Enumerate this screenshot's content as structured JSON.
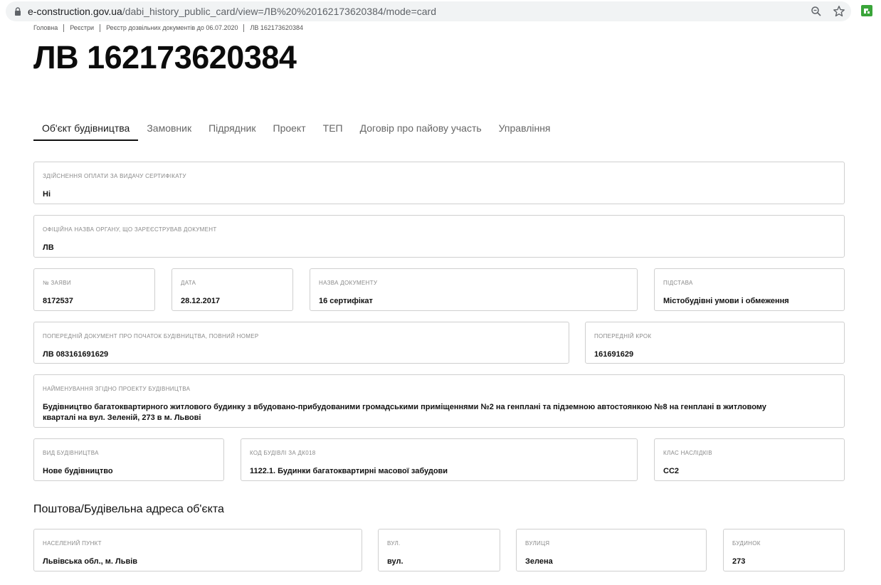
{
  "browser": {
    "url_host": "e-construction.gov.ua",
    "url_path": "/dabi_history_public_card/view=ЛВ%20%20162173620384/mode=card"
  },
  "breadcrumb": [
    "Головна",
    "Реєстри",
    "Реєстр дозвільних документів до 06.07.2020",
    "ЛВ 162173620384"
  ],
  "page_title": "ЛВ 162173620384",
  "tabs": [
    "Об'єкт будівництва",
    "Замовник",
    "Підрядник",
    "Проект",
    "ТЕП",
    "Договір про пайову участь",
    "Управління"
  ],
  "fields": {
    "payment": {
      "label": "Здійснення оплати за видачу сертифікату",
      "value": "Ні"
    },
    "authority": {
      "label": "Офіційна назва органу, що зареєстрував документ",
      "value": "ЛВ"
    },
    "application_no": {
      "label": "№ заяви",
      "value": "8172537"
    },
    "date": {
      "label": "Дата",
      "value": "28.12.2017"
    },
    "doc_name": {
      "label": "Назва документу",
      "value": "16 сертифікат"
    },
    "basis": {
      "label": "Підстава",
      "value": "Містобудівні умови і обмеження"
    },
    "prev_doc": {
      "label": "Попередній документ про початок будівництва, повний номер",
      "value": "ЛВ 083161691629"
    },
    "prev_step": {
      "label": "Попередній крок",
      "value": "161691629"
    },
    "project_name": {
      "label": "Найменування згідно проекту будівництва",
      "value": "Будівництво багатоквартирного житлового будинку з вбудовано-прибудованими громадськими приміщеннями №2 на генплані та підземною автостоянкою №8 на генплані в житловому кварталі на вул. Зеленій, 273 в м. Львові"
    },
    "construction_type": {
      "label": "Вид будівництва",
      "value": "Нове будівництво"
    },
    "building_code": {
      "label": "Код будівлі за ДК018",
      "value": "1122.1. Будинки багатоквартирні масової забудови"
    },
    "consequence_class": {
      "label": "Клас наслідків",
      "value": "СС2"
    }
  },
  "address_section": {
    "title": "Поштова/Будівельна адреса об'єкта",
    "locality": {
      "label": "Населений пункт",
      "value": "Львівська обл., м. Львів"
    },
    "street_type": {
      "label": "Вул.",
      "value": "вул."
    },
    "street": {
      "label": "Вулиця",
      "value": "Зелена"
    },
    "building": {
      "label": "Будинок",
      "value": "273"
    }
  },
  "icons": {
    "lock": "lock-icon",
    "zoom": "zoom-icon",
    "star": "star-icon",
    "extension": "extension-icon"
  },
  "colors": {
    "extension_green": "#3aa53a",
    "tab_underline": "#111111",
    "field_border": "#cfcfcf"
  }
}
